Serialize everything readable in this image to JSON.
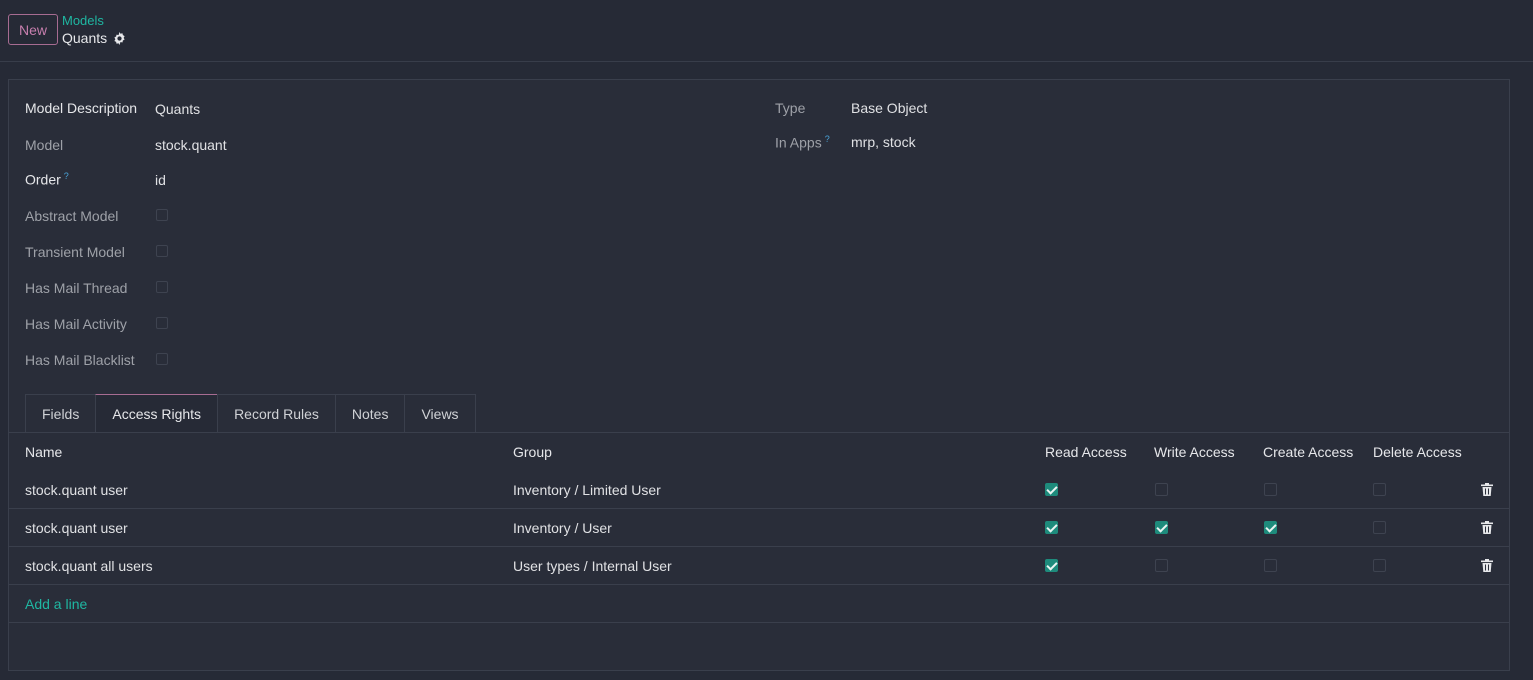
{
  "toolbar": {
    "new_label": "New"
  },
  "breadcrumb": {
    "parent": "Models",
    "current": "Quants"
  },
  "form": {
    "left": [
      {
        "label": "Model Description",
        "value": "Quants"
      },
      {
        "label": "Model",
        "value": "stock.quant"
      },
      {
        "label": "Order",
        "help": "?",
        "value": "id"
      },
      {
        "label": "Abstract Model",
        "checked": false
      },
      {
        "label": "Transient Model",
        "checked": false
      },
      {
        "label": "Has Mail Thread",
        "checked": false
      },
      {
        "label": "Has Mail Activity",
        "checked": false
      },
      {
        "label": "Has Mail Blacklist",
        "checked": false
      }
    ],
    "right": [
      {
        "label": "Type",
        "value": "Base Object"
      },
      {
        "label": "In Apps",
        "help": "?",
        "value": "mrp, stock"
      }
    ]
  },
  "tabs": [
    {
      "label": "Fields"
    },
    {
      "label": "Access Rights",
      "active": true
    },
    {
      "label": "Record Rules"
    },
    {
      "label": "Notes"
    },
    {
      "label": "Views"
    }
  ],
  "table": {
    "columns": [
      "Name",
      "Group",
      "Read Access",
      "Write Access",
      "Create Access",
      "Delete Access"
    ],
    "rows": [
      {
        "name": "stock.quant user",
        "group": "Inventory / Limited User",
        "read": true,
        "write": false,
        "create": false,
        "delete": false
      },
      {
        "name": "stock.quant user",
        "group": "Inventory / User",
        "read": true,
        "write": true,
        "create": true,
        "delete": false
      },
      {
        "name": "stock.quant all users",
        "group": "User types / Internal User",
        "read": true,
        "write": false,
        "create": false,
        "delete": false
      }
    ],
    "add_line": "Add a line"
  },
  "colors": {
    "accent": "#1fb7a2",
    "brand": "#a76c92",
    "checked": "#1e8b7c"
  },
  "icons": {
    "settings": "gear-icon",
    "delete": "trash-icon"
  }
}
